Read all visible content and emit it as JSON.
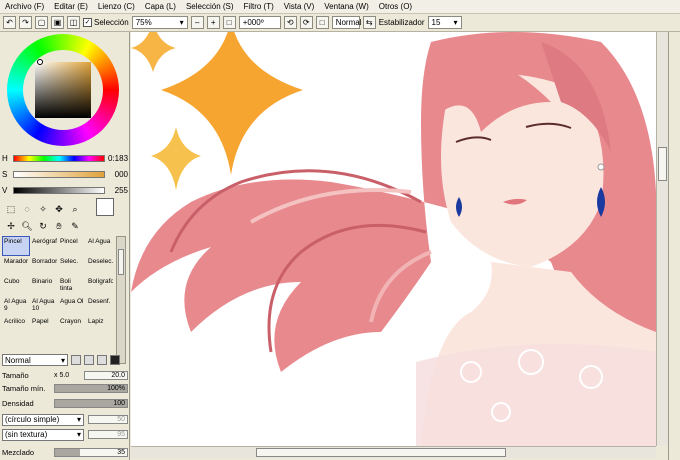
{
  "menubar": {
    "items": [
      "Archivo (F)",
      "Editar (E)",
      "Lienzo (C)",
      "Capa (L)",
      "Selección (S)",
      "Filtro (T)",
      "Vista (V)",
      "Ventana (W)",
      "Otros (O)"
    ]
  },
  "toolbar": {
    "selection_label": "Selección",
    "zoom_value": "75%",
    "rotation_value": "+000º",
    "mode_label": "Normal",
    "stabilizer_label": "Estabilizador",
    "stabilizer_value": "15"
  },
  "color": {
    "h_label": "H",
    "h_value": "0:183",
    "s_label": "S",
    "s_value": "000",
    "v_label": "V",
    "v_value": "255",
    "main_hue": "#e0a33a"
  },
  "brushes": [
    {
      "label": "Pincel",
      "selected": true
    },
    {
      "label": "Aerógraf",
      "selected": false
    },
    {
      "label": "Pincel",
      "selected": false
    },
    {
      "label": "Al Agua",
      "selected": false
    },
    {
      "label": "Marador",
      "selected": false
    },
    {
      "label": "Borrador",
      "selected": false
    },
    {
      "label": "Selec.",
      "selected": false
    },
    {
      "label": "Deselec.",
      "selected": false
    },
    {
      "label": "Cubo",
      "selected": false
    },
    {
      "label": "Binario",
      "selected": false
    },
    {
      "label": "Boli tinta",
      "selected": false
    },
    {
      "label": "Bolígrafo",
      "selected": false
    },
    {
      "label": "Al Agua 9",
      "selected": false
    },
    {
      "label": "Al Agua 10",
      "selected": false
    },
    {
      "label": "Agua Ol",
      "selected": false
    },
    {
      "label": "Desenf.",
      "selected": false
    },
    {
      "label": "Acrilico",
      "selected": false
    },
    {
      "label": "Papel",
      "selected": false
    },
    {
      "label": "Crayon",
      "selected": false
    },
    {
      "label": "Lapiz",
      "selected": false
    }
  ],
  "brush_settings": {
    "blend_mode": "Normal",
    "size_label": "Tamaño",
    "size_mult": "x 5.0",
    "size_value": "20.0",
    "min_size_label": "Tamaño mín.",
    "min_size_value": "100%",
    "density_label": "Densidad",
    "density_value": "100",
    "shape_select": "(círculo simple)",
    "shape_value": "50",
    "texture_select": "(sin textura)",
    "texture_value": "95",
    "mix_label": "Mezclado",
    "mix_value": "35"
  }
}
